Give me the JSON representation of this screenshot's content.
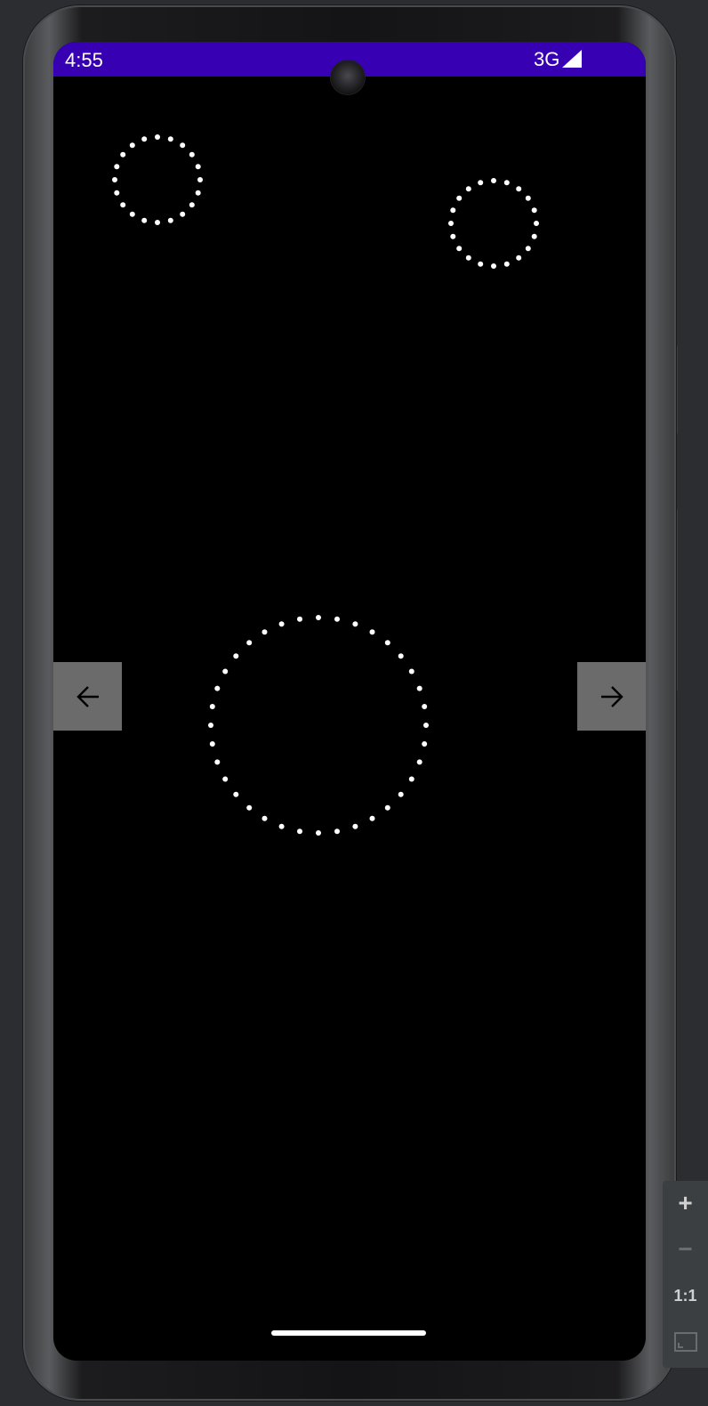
{
  "status_bar": {
    "time": "4:55",
    "network": "3G",
    "background_color": "#3700b3"
  },
  "icons": {
    "signal": "cellular-signal-icon",
    "camera": "front-camera-icon",
    "prev": "arrow-left-icon",
    "next": "arrow-right-icon",
    "zoom_in": "plus-icon",
    "zoom_out": "minus-icon",
    "fit": "fit-screen-icon"
  },
  "content": {
    "background_color": "#000000",
    "dot_color": "#ffffff",
    "circles": [
      {
        "name": "dotted-circle-top-left",
        "dots": 20
      },
      {
        "name": "dotted-circle-top-right",
        "dots": 20
      },
      {
        "name": "dotted-circle-center",
        "dots": 36
      }
    ]
  },
  "nav_buttons": {
    "background_color": "#6b6b6b"
  },
  "emulator_controls": {
    "zoom_in_label": "+",
    "zoom_out_label": "−",
    "actual_size_label": "1:1"
  }
}
